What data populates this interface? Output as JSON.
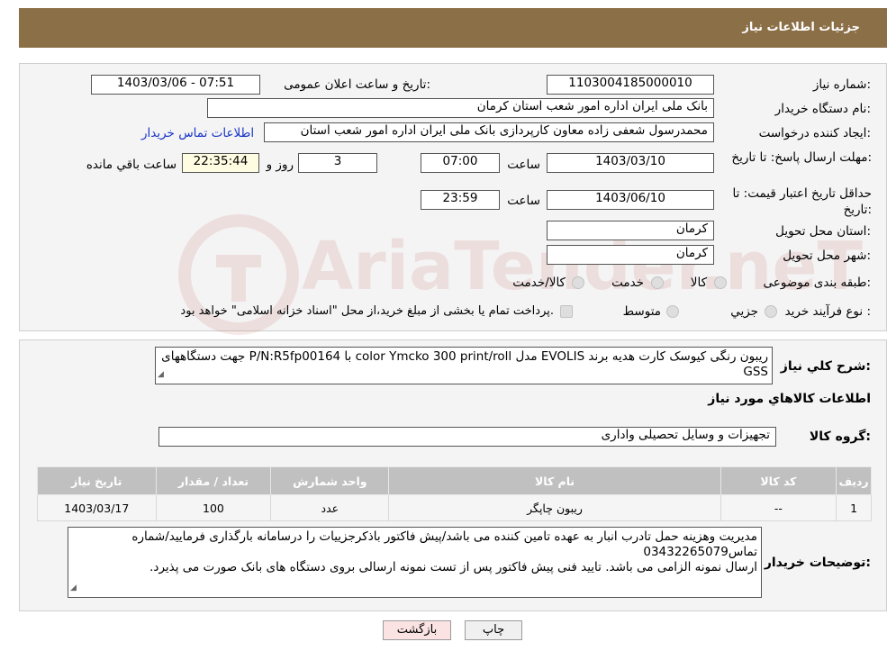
{
  "header": {
    "title": "جزئیات اطلاعات نیاز"
  },
  "fields": {
    "need_number_label": "شماره نیاز:",
    "need_number": "1103004185000010",
    "announce_label": "تاریخ و ساعت اعلان عمومی:",
    "announce_value": "1403/03/06 - 07:51",
    "buyer_org_label": "نام دستگاه خریدار:",
    "buyer_org": "بانک ملی ایران اداره امور شعب استان کرمان",
    "creator_label": "ایجاد کننده درخواست:",
    "creator": "محمدرسول شعفی زاده معاون کارپردازی بانک ملی ایران اداره امور شعب استان",
    "contact_link": "اطلاعات تماس خریدار",
    "deadline_label": "مهلت ارسال پاسخ: تا تاریخ:",
    "deadline_date": "1403/03/10",
    "time_label": "ساعت",
    "deadline_time": "07:00",
    "days_value": "3",
    "days_label": "روز و",
    "remaining_value": "22:35:44",
    "remaining_label": "ساعت باقي مانده",
    "validity_label": "حداقل تاریخ اعتبار قیمت: تا تاریخ:",
    "validity_date": "1403/06/10",
    "validity_time": "23:59",
    "province_label": "استان محل تحویل:",
    "province": "کرمان",
    "city_label": "شهر محل تحویل:",
    "city": "کرمان",
    "category_label": "طبقه بندی موضوعی:",
    "category_options": [
      "کالا",
      "خدمت",
      "کالا/خدمت"
    ],
    "process_label": "نوع فرآیند خرید :",
    "process_options": [
      "جزيي",
      "متوسط"
    ],
    "payment_note": "پرداخت تمام یا بخشی از مبلغ خرید،از محل \"اسناد خزانه اسلامی\" خواهد بود."
  },
  "description": {
    "label": "شرح كلي نياز:",
    "text": "ریبون رنگی کیوسک کارت هدیه برند EVOLIS مدل color Ymcko 300 print/roll با P/N:R5fp00164 جهت دستگاههای GSS"
  },
  "goods_section": {
    "title": "اطلاعات كالاهاي مورد نياز",
    "group_label": "گروه کالا:",
    "group_value": "تجهیزات و وسایل تحصیلی واداری"
  },
  "table": {
    "headers": [
      "رديف",
      "کد کالا",
      "نام کالا",
      "واحد شمارش",
      "تعداد / مقدار",
      "تاریخ نیاز"
    ],
    "rows": [
      [
        "1",
        "--",
        "ریبون چاپگر",
        "عدد",
        "100",
        "1403/03/17"
      ]
    ]
  },
  "buyer_notes": {
    "label": "توضيحات خريدار:",
    "line1": "مدیریت وهزینه حمل تادرب انبار به عهده تامین کننده می باشد/پیش فاکتور باذکرجزییات را درسامانه بارگذاری فرمایید/شماره تماس03432265079",
    "line2": "ارسال نمونه الزامی می باشد. تایید فنی پیش فاکتور پس از تست نمونه ارسالی بروی دستگاه های بانک صورت می پذیرد."
  },
  "buttons": {
    "print": "چاپ",
    "back": "بازگشت"
  },
  "watermark": {
    "text": "AriaTender.neT"
  },
  "colors": {
    "header_bg": "#8b6f47",
    "link": "#1a35c8",
    "table_header": "#c0c0c0",
    "back_button": "#fbe3e3"
  }
}
